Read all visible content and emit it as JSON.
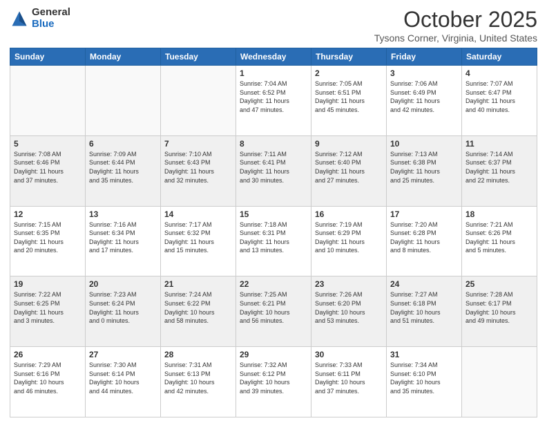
{
  "logo": {
    "general": "General",
    "blue": "Blue"
  },
  "header": {
    "month": "October 2025",
    "location": "Tysons Corner, Virginia, United States"
  },
  "weekdays": [
    "Sunday",
    "Monday",
    "Tuesday",
    "Wednesday",
    "Thursday",
    "Friday",
    "Saturday"
  ],
  "weeks": [
    [
      {
        "day": "",
        "info": ""
      },
      {
        "day": "",
        "info": ""
      },
      {
        "day": "",
        "info": ""
      },
      {
        "day": "1",
        "info": "Sunrise: 7:04 AM\nSunset: 6:52 PM\nDaylight: 11 hours\nand 47 minutes."
      },
      {
        "day": "2",
        "info": "Sunrise: 7:05 AM\nSunset: 6:51 PM\nDaylight: 11 hours\nand 45 minutes."
      },
      {
        "day": "3",
        "info": "Sunrise: 7:06 AM\nSunset: 6:49 PM\nDaylight: 11 hours\nand 42 minutes."
      },
      {
        "day": "4",
        "info": "Sunrise: 7:07 AM\nSunset: 6:47 PM\nDaylight: 11 hours\nand 40 minutes."
      }
    ],
    [
      {
        "day": "5",
        "info": "Sunrise: 7:08 AM\nSunset: 6:46 PM\nDaylight: 11 hours\nand 37 minutes."
      },
      {
        "day": "6",
        "info": "Sunrise: 7:09 AM\nSunset: 6:44 PM\nDaylight: 11 hours\nand 35 minutes."
      },
      {
        "day": "7",
        "info": "Sunrise: 7:10 AM\nSunset: 6:43 PM\nDaylight: 11 hours\nand 32 minutes."
      },
      {
        "day": "8",
        "info": "Sunrise: 7:11 AM\nSunset: 6:41 PM\nDaylight: 11 hours\nand 30 minutes."
      },
      {
        "day": "9",
        "info": "Sunrise: 7:12 AM\nSunset: 6:40 PM\nDaylight: 11 hours\nand 27 minutes."
      },
      {
        "day": "10",
        "info": "Sunrise: 7:13 AM\nSunset: 6:38 PM\nDaylight: 11 hours\nand 25 minutes."
      },
      {
        "day": "11",
        "info": "Sunrise: 7:14 AM\nSunset: 6:37 PM\nDaylight: 11 hours\nand 22 minutes."
      }
    ],
    [
      {
        "day": "12",
        "info": "Sunrise: 7:15 AM\nSunset: 6:35 PM\nDaylight: 11 hours\nand 20 minutes."
      },
      {
        "day": "13",
        "info": "Sunrise: 7:16 AM\nSunset: 6:34 PM\nDaylight: 11 hours\nand 17 minutes."
      },
      {
        "day": "14",
        "info": "Sunrise: 7:17 AM\nSunset: 6:32 PM\nDaylight: 11 hours\nand 15 minutes."
      },
      {
        "day": "15",
        "info": "Sunrise: 7:18 AM\nSunset: 6:31 PM\nDaylight: 11 hours\nand 13 minutes."
      },
      {
        "day": "16",
        "info": "Sunrise: 7:19 AM\nSunset: 6:29 PM\nDaylight: 11 hours\nand 10 minutes."
      },
      {
        "day": "17",
        "info": "Sunrise: 7:20 AM\nSunset: 6:28 PM\nDaylight: 11 hours\nand 8 minutes."
      },
      {
        "day": "18",
        "info": "Sunrise: 7:21 AM\nSunset: 6:26 PM\nDaylight: 11 hours\nand 5 minutes."
      }
    ],
    [
      {
        "day": "19",
        "info": "Sunrise: 7:22 AM\nSunset: 6:25 PM\nDaylight: 11 hours\nand 3 minutes."
      },
      {
        "day": "20",
        "info": "Sunrise: 7:23 AM\nSunset: 6:24 PM\nDaylight: 11 hours\nand 0 minutes."
      },
      {
        "day": "21",
        "info": "Sunrise: 7:24 AM\nSunset: 6:22 PM\nDaylight: 10 hours\nand 58 minutes."
      },
      {
        "day": "22",
        "info": "Sunrise: 7:25 AM\nSunset: 6:21 PM\nDaylight: 10 hours\nand 56 minutes."
      },
      {
        "day": "23",
        "info": "Sunrise: 7:26 AM\nSunset: 6:20 PM\nDaylight: 10 hours\nand 53 minutes."
      },
      {
        "day": "24",
        "info": "Sunrise: 7:27 AM\nSunset: 6:18 PM\nDaylight: 10 hours\nand 51 minutes."
      },
      {
        "day": "25",
        "info": "Sunrise: 7:28 AM\nSunset: 6:17 PM\nDaylight: 10 hours\nand 49 minutes."
      }
    ],
    [
      {
        "day": "26",
        "info": "Sunrise: 7:29 AM\nSunset: 6:16 PM\nDaylight: 10 hours\nand 46 minutes."
      },
      {
        "day": "27",
        "info": "Sunrise: 7:30 AM\nSunset: 6:14 PM\nDaylight: 10 hours\nand 44 minutes."
      },
      {
        "day": "28",
        "info": "Sunrise: 7:31 AM\nSunset: 6:13 PM\nDaylight: 10 hours\nand 42 minutes."
      },
      {
        "day": "29",
        "info": "Sunrise: 7:32 AM\nSunset: 6:12 PM\nDaylight: 10 hours\nand 39 minutes."
      },
      {
        "day": "30",
        "info": "Sunrise: 7:33 AM\nSunset: 6:11 PM\nDaylight: 10 hours\nand 37 minutes."
      },
      {
        "day": "31",
        "info": "Sunrise: 7:34 AM\nSunset: 6:10 PM\nDaylight: 10 hours\nand 35 minutes."
      },
      {
        "day": "",
        "info": ""
      }
    ]
  ]
}
